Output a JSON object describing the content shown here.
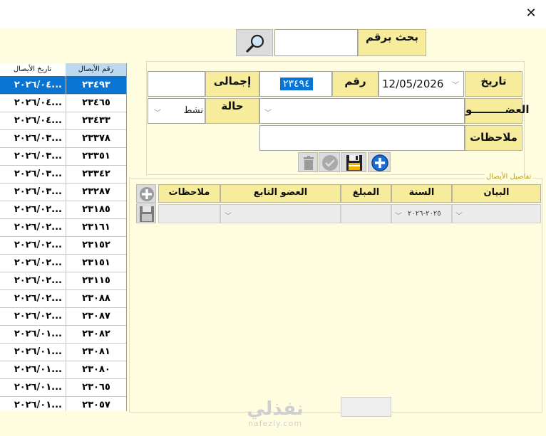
{
  "window": {
    "close_glyph": "✕"
  },
  "search": {
    "label": "بحث برقم",
    "value": ""
  },
  "form": {
    "date_label": "تاريخ",
    "date_value": "12/05/2026",
    "number_label": "رقم",
    "number_value": "٢٣٤٩٤",
    "total_label": "إجمالى",
    "total_value": "",
    "member_label": "العضـــــــــو",
    "member_value": "",
    "status_label": "حالة",
    "status_value": "نشط",
    "notes_label": "ملاحظات",
    "notes_value": ""
  },
  "details": {
    "title": "تفاصيل الأيصال",
    "columns": [
      "البيان",
      "السنة",
      "المبلغ",
      "العضو التابع",
      "ملاحظات"
    ],
    "row": {
      "year": "٢٠٢٥-٢٠٢٦"
    }
  },
  "list": {
    "col_number": "رقم الأيصال",
    "col_date": "تاريخ الأيصال",
    "rows": [
      {
        "num": "٢٣٤٩٣",
        "date": "٢٠٢٦/٠٤..."
      },
      {
        "num": "٢٣٤٦٥",
        "date": "٢٠٢٦/٠٤..."
      },
      {
        "num": "٢٣٤٣٣",
        "date": "٢٠٢٦/٠٤..."
      },
      {
        "num": "٢٣٣٧٨",
        "date": "٢٠٢٦/٠٣..."
      },
      {
        "num": "٢٣٣٥١",
        "date": "٢٠٢٦/٠٣..."
      },
      {
        "num": "٢٣٣٤٢",
        "date": "٢٠٢٦/٠٣..."
      },
      {
        "num": "٢٣٢٨٧",
        "date": "٢٠٢٦/٠٣..."
      },
      {
        "num": "٢٣١٨٥",
        "date": "٢٠٢٦/٠٢..."
      },
      {
        "num": "٢٣١٦١",
        "date": "٢٠٢٦/٠٢..."
      },
      {
        "num": "٢٣١٥٢",
        "date": "٢٠٢٦/٠٢..."
      },
      {
        "num": "٢٣١٥١",
        "date": "٢٠٢٦/٠٢..."
      },
      {
        "num": "٢٣١١٥",
        "date": "٢٠٢٦/٠٢..."
      },
      {
        "num": "٢٣٠٨٨",
        "date": "٢٠٢٦/٠٢..."
      },
      {
        "num": "٢٣٠٨٧",
        "date": "٢٠٢٦/٠٢..."
      },
      {
        "num": "٢٣٠٨٢",
        "date": "٢٠٢٦/٠١..."
      },
      {
        "num": "٢٣٠٨١",
        "date": "٢٠٢٦/٠١..."
      },
      {
        "num": "٢٣٠٨٠",
        "date": "٢٠٢٦/٠١..."
      },
      {
        "num": "٢٣٠٦٥",
        "date": "٢٠٢٦/٠١..."
      },
      {
        "num": "٢٣٠٥٧",
        "date": "٢٠٢٦/٠١..."
      }
    ]
  },
  "watermark": {
    "text": "نفذلي",
    "sub": "nafezly.com"
  }
}
